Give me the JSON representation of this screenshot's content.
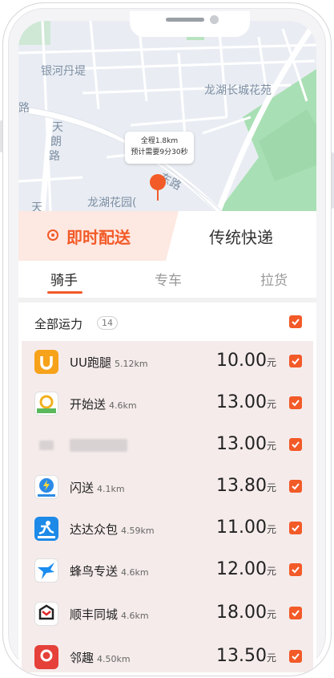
{
  "map": {
    "labels": {
      "yinhe": "银河丹堤",
      "longhu_changcheng": "龙湖长城花苑",
      "road_tian": "天\n朗\n路",
      "road_tianhe": "天",
      "road_lu": "路",
      "road_dong": "东路",
      "longhu_garden": "龙湖花园(",
      "road_vertical2": "天"
    },
    "bubble_line1": "全程1.8km",
    "bubble_line2": "预计需要9分30秒"
  },
  "mode_tabs": {
    "active": "即时配送",
    "inactive": "传统快递"
  },
  "sub_tabs": [
    "骑手",
    "专车",
    "拉货"
  ],
  "list": {
    "header_title": "全部运力",
    "header_count": "14",
    "rows": [
      {
        "name": "UU跑腿",
        "distance": "5.12km",
        "price": "10.00",
        "unit": "元"
      },
      {
        "name": "开始送",
        "distance": "4.6km",
        "price": "13.00",
        "unit": "元"
      },
      {
        "name": "",
        "distance": "",
        "price": "13.00",
        "unit": "元"
      },
      {
        "name": "闪送",
        "distance": "4.1km",
        "price": "13.80",
        "unit": "元"
      },
      {
        "name": "达达众包",
        "distance": "4.59km",
        "price": "11.00",
        "unit": "元"
      },
      {
        "name": "蜂鸟专送",
        "distance": "4.6km",
        "price": "12.00",
        "unit": "元"
      },
      {
        "name": "顺丰同城",
        "distance": "4.6km",
        "price": "18.00",
        "unit": "元"
      },
      {
        "name": "邻趣",
        "distance": "4.50km",
        "price": "13.50",
        "unit": "元"
      }
    ]
  },
  "colors": {
    "accent": "#f25a28",
    "list_bg": "#f5ebeb",
    "map_bg": "#e9edf3",
    "park_green": "#a9dfb4"
  }
}
